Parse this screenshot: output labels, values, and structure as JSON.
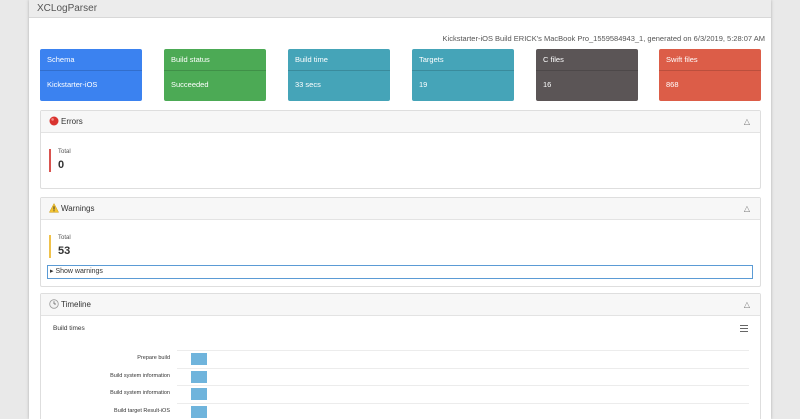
{
  "app": {
    "title": "XCLogParser"
  },
  "header": {
    "subtitle": "Kickstarter-iOS Build ERICK's MacBook Pro_1559584943_1, generated on 6/3/2019, 5:28:07 AM"
  },
  "summary_cards": [
    {
      "label": "Schema",
      "value": "Kickstarter-iOS",
      "color": "#3b82f0"
    },
    {
      "label": "Build status",
      "value": "Succeeded",
      "color": "#4caa55"
    },
    {
      "label": "Build time",
      "value": "33 secs",
      "color": "#45a4b8"
    },
    {
      "label": "Targets",
      "value": "19",
      "color": "#45a4b8"
    },
    {
      "label": "C files",
      "value": "16",
      "color": "#5b5556"
    },
    {
      "label": "Swift files",
      "value": "868",
      "color": "#dc5d48"
    }
  ],
  "errors": {
    "title": "Errors",
    "total_label": "Total",
    "total": "0",
    "accent": "#d9534f"
  },
  "warnings": {
    "title": "Warnings",
    "total_label": "Total",
    "total": "53",
    "accent": "#f0c24b",
    "show_label": "▸ Show warnings"
  },
  "timeline": {
    "title": "Timeline",
    "chart_title": "Build times",
    "rows": [
      {
        "label": "Prepare build"
      },
      {
        "label": "Build system information"
      },
      {
        "label": "Build system information"
      },
      {
        "label": "Build target Result-iOS"
      }
    ]
  }
}
